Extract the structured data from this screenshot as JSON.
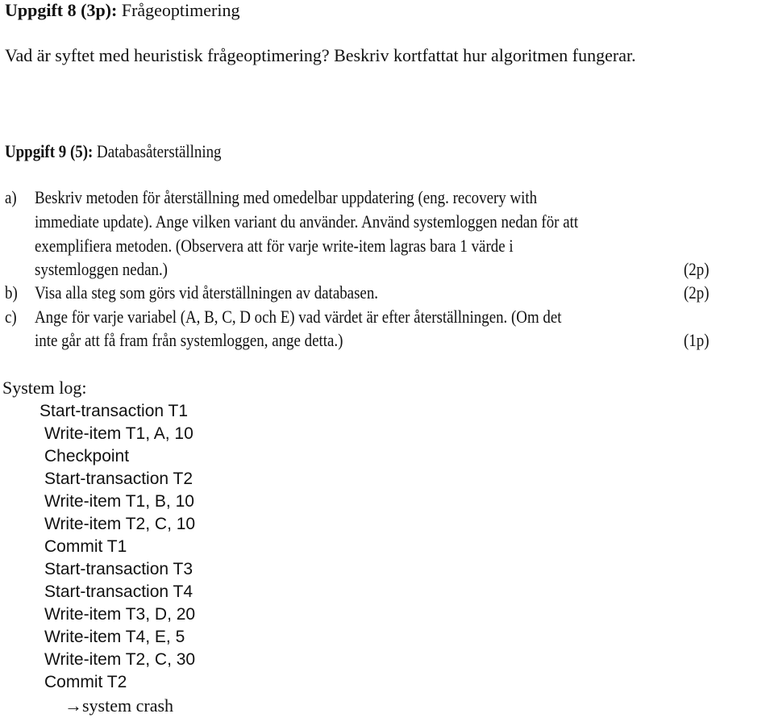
{
  "task8": {
    "heading_bold": "Uppgift 8 (3p):",
    "heading_title": "Frågeoptimering",
    "question": "Vad är syftet med heuristisk frågeoptimering? Beskriv kortfattat hur algoritmen fungerar."
  },
  "task9": {
    "heading_bold": "Uppgift 9 (5):",
    "heading_title": "Databasåterställning",
    "a": {
      "marker": "a)",
      "lines": [
        "Beskriv metoden för återställning med omedelbar uppdatering  (eng. recovery with",
        "immediate update). Ange vilken variant du använder. Använd systemloggen nedan för att",
        "exemplifiera metoden. (Observera att för varje write-item lagras bara 1 värde i",
        "systemloggen nedan.)"
      ],
      "points": "(2p)"
    },
    "b": {
      "marker": "b)",
      "lines": [
        "Visa alla steg som görs vid återställningen av databasen."
      ],
      "points": "(2p)"
    },
    "c": {
      "marker": "c)",
      "lines": [
        "Ange för varje variabel (A, B, C, D och E) vad värdet är efter återställningen. (Om det",
        "inte går att få fram från systemloggen, ange detta.)"
      ],
      "points": "(1p)"
    }
  },
  "system_log": {
    "label": "System log:",
    "entries": [
      "Start-transaction T1",
      "Write-item T1, A, 10",
      "Checkpoint",
      "Start-transaction T2",
      "Write-item T1, B, 10",
      "Write-item T2, C, 10",
      "Commit T1",
      "Start-transaction T3",
      "Start-transaction T4",
      "Write-item T3, D, 20",
      "Write-item T4, E, 5",
      "Write-item T2, C, 30",
      "Commit T2"
    ],
    "crash_arrow": "→",
    "crash_text": "system crash"
  }
}
